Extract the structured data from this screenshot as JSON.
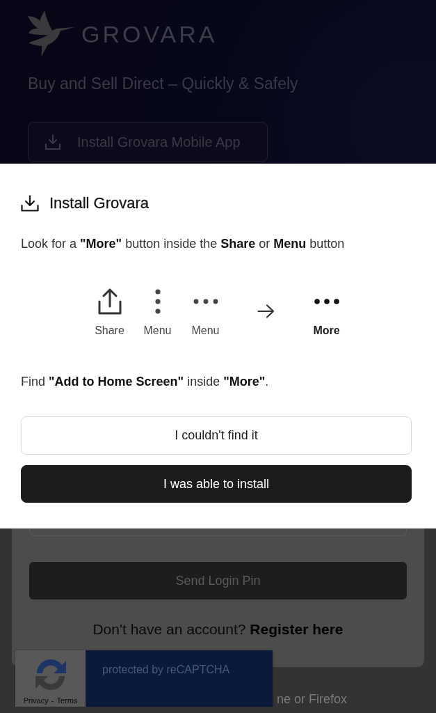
{
  "background": {
    "logo": {
      "wordmark": "GROVARA"
    },
    "tagline": "Buy and Sell Direct – Quickly & Safely",
    "install_button": "Install Grovara Mobile App"
  },
  "dialog": {
    "title": "Install Grovara",
    "instruction": "Look for a **\"More\"** button inside the **Share** or **Menu** button",
    "steps": [
      {
        "kind": "share",
        "label": "Share"
      },
      {
        "kind": "menu-vertical",
        "label": "Menu"
      },
      {
        "kind": "menu-horizontal",
        "label": "Menu"
      },
      {
        "kind": "arrow"
      },
      {
        "kind": "more",
        "label": "More"
      }
    ],
    "hint": "Find **\"Add to Home Screen\"** inside **\"More\"**.",
    "buttons": [
      {
        "kind": "secondary",
        "label": "I couldn't find it"
      },
      {
        "kind": "primary",
        "label": "I was able to install"
      }
    ]
  },
  "login": {
    "send_button": "Send Login Pin",
    "register_prompt": "Don't have an account?",
    "register_link": "Register here",
    "browser_note": "ne or Firefox"
  },
  "recaptcha": {
    "text": "protected by reCAPTCHA",
    "links": [
      {
        "label": "Privacy"
      },
      {
        "label": "Terms"
      }
    ],
    "separator": "-"
  }
}
